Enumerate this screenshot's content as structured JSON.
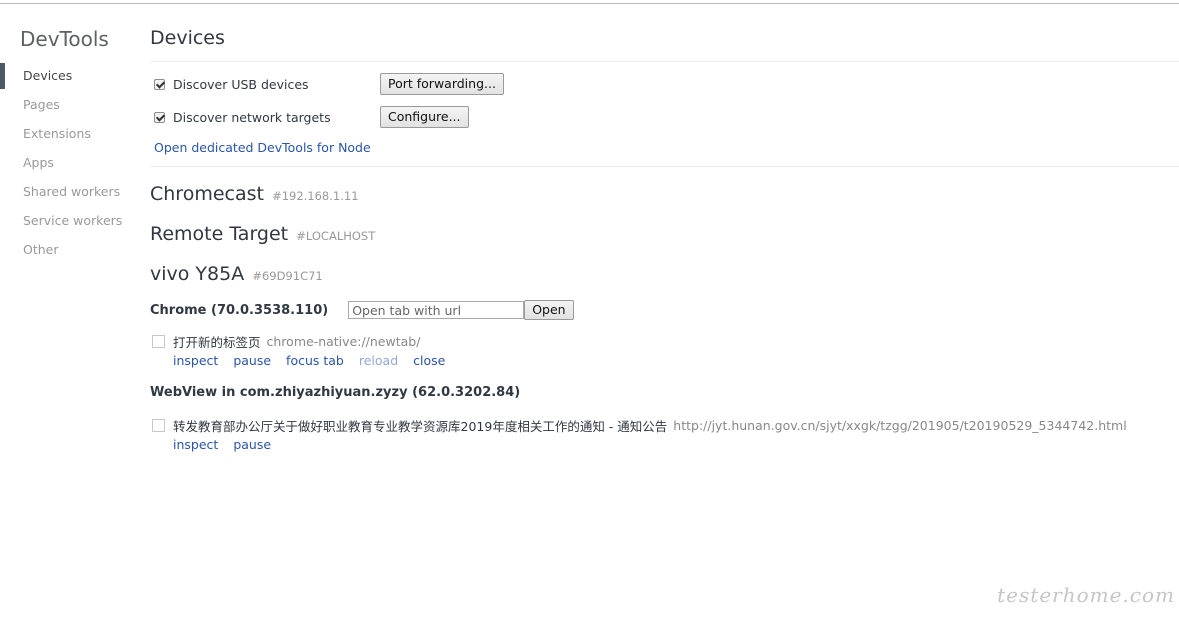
{
  "sidebar": {
    "title": "DevTools",
    "items": [
      {
        "label": "Devices",
        "selected": true
      },
      {
        "label": "Pages",
        "selected": false
      },
      {
        "label": "Extensions",
        "selected": false
      },
      {
        "label": "Apps",
        "selected": false
      },
      {
        "label": "Shared workers",
        "selected": false
      },
      {
        "label": "Service workers",
        "selected": false
      },
      {
        "label": "Other",
        "selected": false
      }
    ]
  },
  "main": {
    "title": "Devices",
    "options": {
      "usb": {
        "label": "Discover USB devices",
        "checked": true,
        "button": "Port forwarding..."
      },
      "network": {
        "label": "Discover network targets",
        "checked": true,
        "button": "Configure..."
      }
    },
    "node_link": "Open dedicated DevTools for Node",
    "devices": [
      {
        "name": "Chromecast",
        "id": "#192.168.1.11"
      },
      {
        "name": "Remote Target",
        "id": "#LOCALHOST"
      },
      {
        "name": "vivo Y85A",
        "id": "#69D91C71"
      }
    ],
    "browser": {
      "name": "Chrome (70.0.3538.110)",
      "url_placeholder": "Open tab with url",
      "open_button": "Open",
      "targets": [
        {
          "title": "打开新的标签页",
          "url": "chrome-native://newtab/",
          "actions": [
            "inspect",
            "pause",
            "focus tab",
            "reload",
            "close"
          ]
        }
      ]
    },
    "webview": {
      "name": "WebView in com.zhiyazhiyuan.zyzy (62.0.3202.84)",
      "targets": [
        {
          "title": "转发教育部办公厅关于做好职业教育专业教学资源库2019年度相关工作的通知 - 通知公告",
          "url": "http://jyt.hunan.gov.cn/sjyt/xxgk/tzgg/201905/t20190529_5344742.html",
          "actions": [
            "inspect",
            "pause"
          ]
        }
      ]
    }
  },
  "watermark": "testerhome.com"
}
